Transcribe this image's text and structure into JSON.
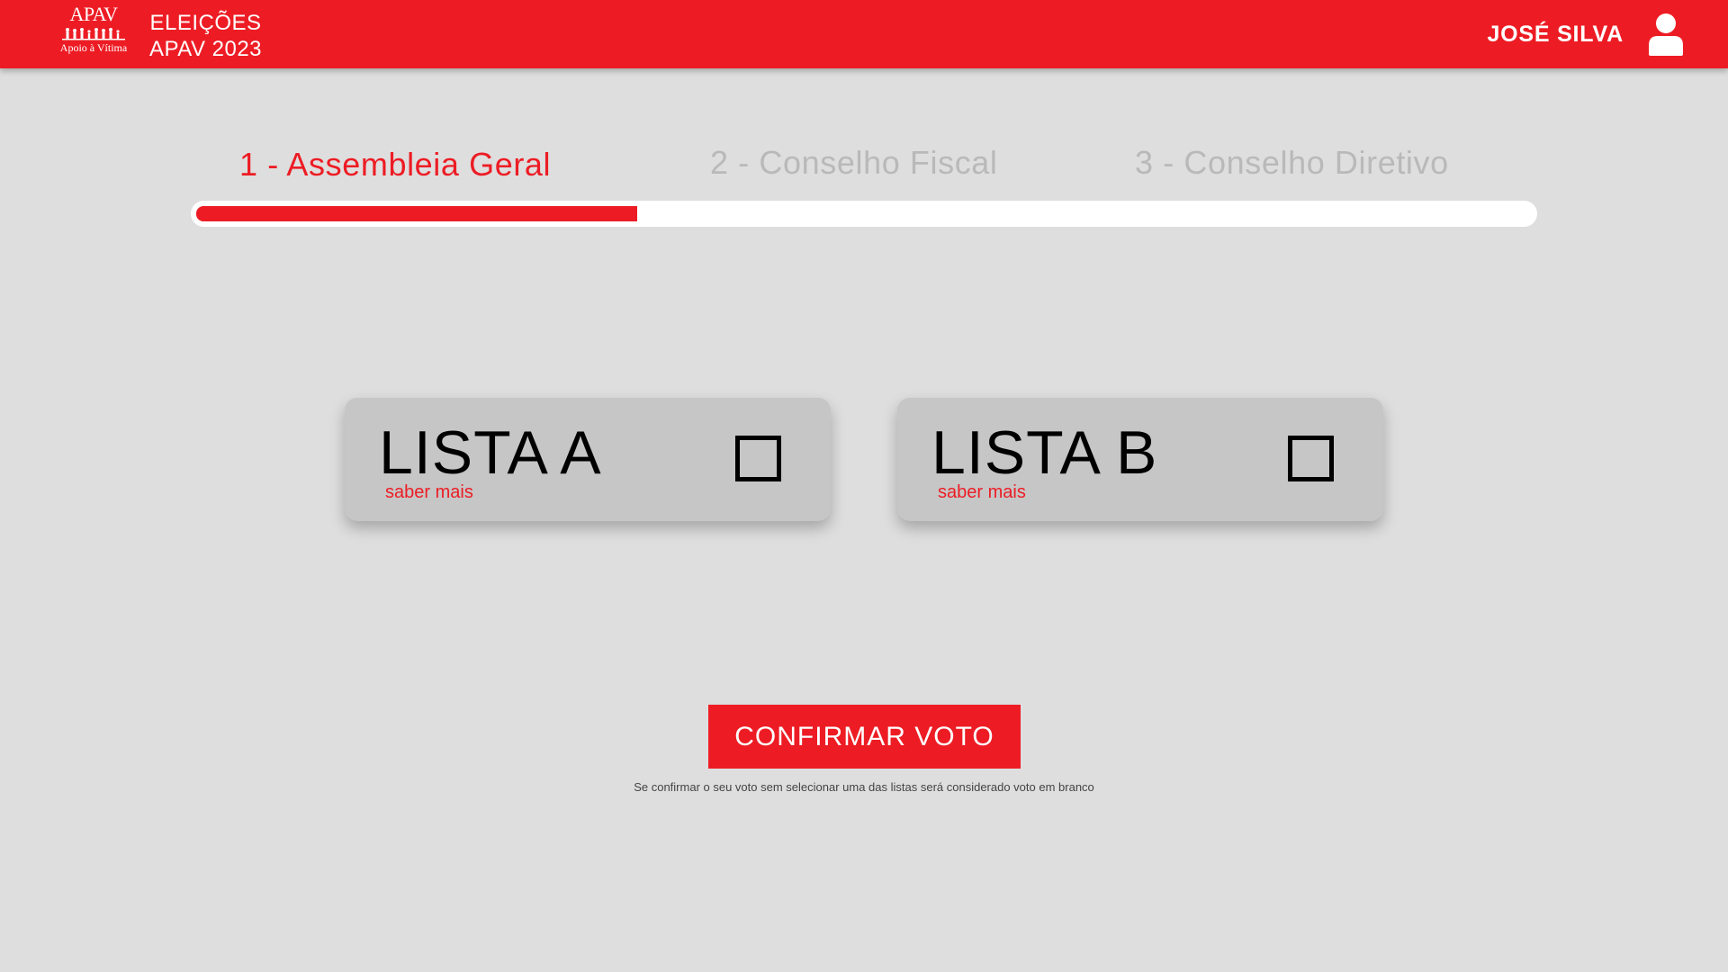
{
  "header": {
    "logo_top": "APAV",
    "logo_bottom": "Apoio à Vítima",
    "title_line1": "ELEIÇÕES",
    "title_line2": "APAV 2023",
    "user_name": "JOSÉ SILVA",
    "user_icon": "user-icon"
  },
  "steps": [
    {
      "label": "1 - Assembleia Geral",
      "active": true
    },
    {
      "label": "2 - Conselho Fiscal",
      "active": false
    },
    {
      "label": "3 - Conselho Diretivo",
      "active": false
    }
  ],
  "progress": {
    "fraction": 0.33
  },
  "lists": [
    {
      "title": "LISTA A",
      "link": "saber mais",
      "checked": false
    },
    {
      "title": "LISTA B",
      "link": "saber mais",
      "checked": false
    }
  ],
  "confirm": {
    "button_label": "CONFIRMAR VOTO",
    "note": "Se confirmar o seu voto sem selecionar uma das listas será considerado voto em branco"
  },
  "colors": {
    "accent": "#ed1c24",
    "background": "#dedede",
    "card": "#c6c6c6",
    "inactive_step": "#b9b9b9"
  }
}
